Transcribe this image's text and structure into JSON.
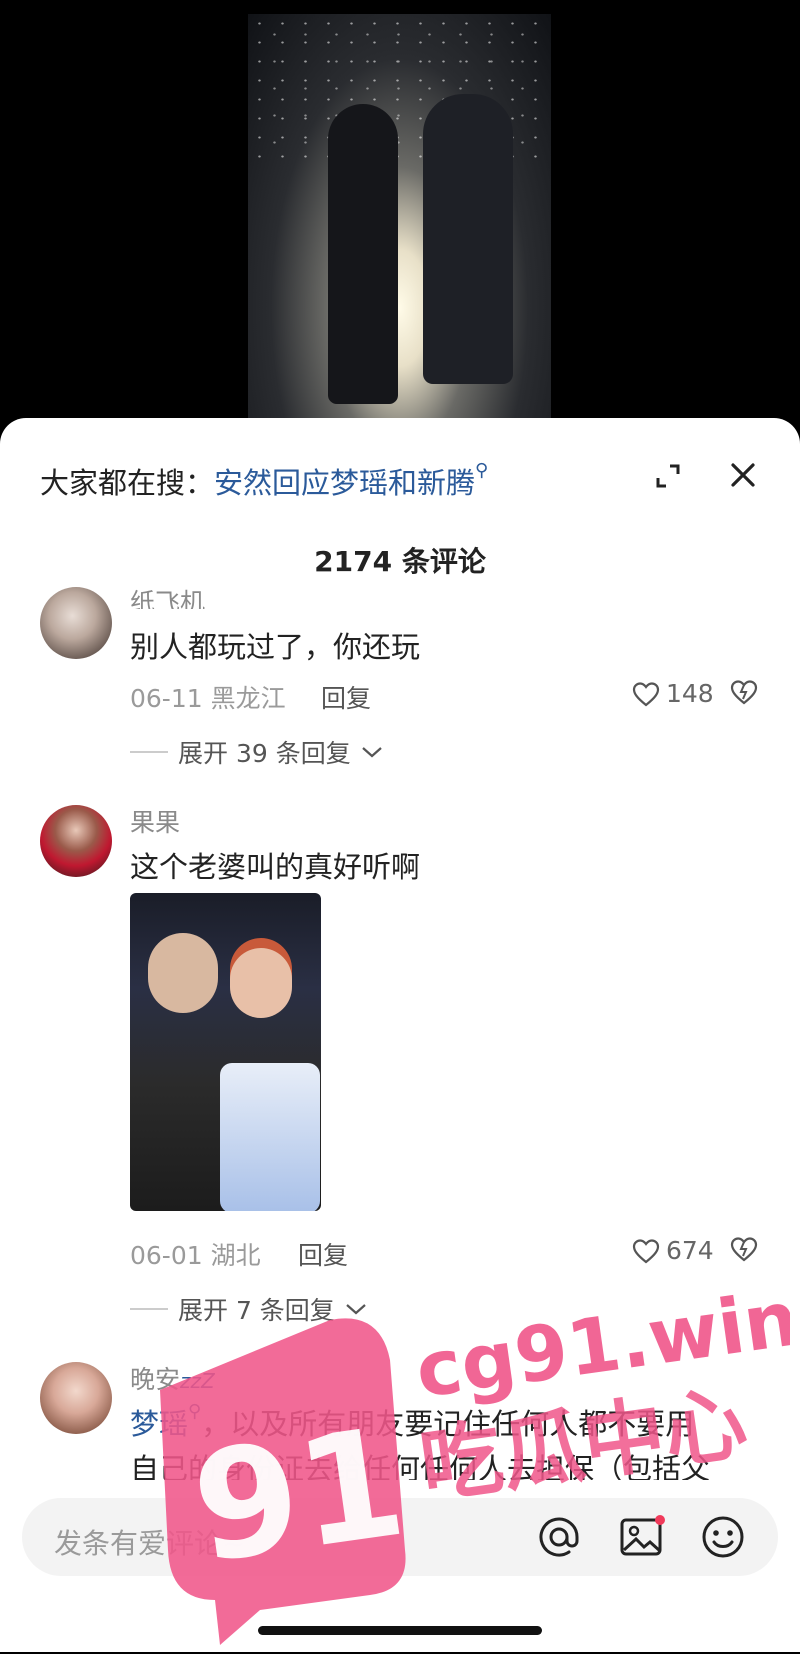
{
  "search_bar": {
    "prefix": "大家都在搜：",
    "query": "安然回应梦瑶和新腾"
  },
  "comment_count": "2174 条评论",
  "comments": [
    {
      "username": "纸飞机",
      "text": "别人都玩过了，你还玩",
      "date": "06-11",
      "location": "黑龙江",
      "reply_label": "回复",
      "likes": "148",
      "expand_label": "展开 39 条回复"
    },
    {
      "username": "果果",
      "text": "这个老婆叫的真好听啊",
      "date": "06-01",
      "location": "湖北",
      "reply_label": "回复",
      "likes": "674",
      "expand_label": "展开 7 条回复"
    },
    {
      "username": "晚安",
      "username_suffix": "zzZ",
      "mention": "梦瑶",
      "text_line1": "，以及所有朋友要记住任何人都不要用",
      "text_line2": "自己的身份证去给任何任何人去担保（包括父"
    }
  ],
  "input": {
    "placeholder": "发条有爱评论~"
  },
  "watermark": {
    "line1": "cg91.win",
    "line2": "吃瓜中心",
    "logo": "91"
  },
  "colors": {
    "accent": "#2b5a9a",
    "watermark": "#f0568a"
  },
  "icons": [
    "search-icon",
    "expand-icon",
    "close-icon",
    "heart-icon",
    "dislike-icon",
    "chevron-down-icon",
    "at-icon",
    "image-icon",
    "emoji-icon"
  ]
}
